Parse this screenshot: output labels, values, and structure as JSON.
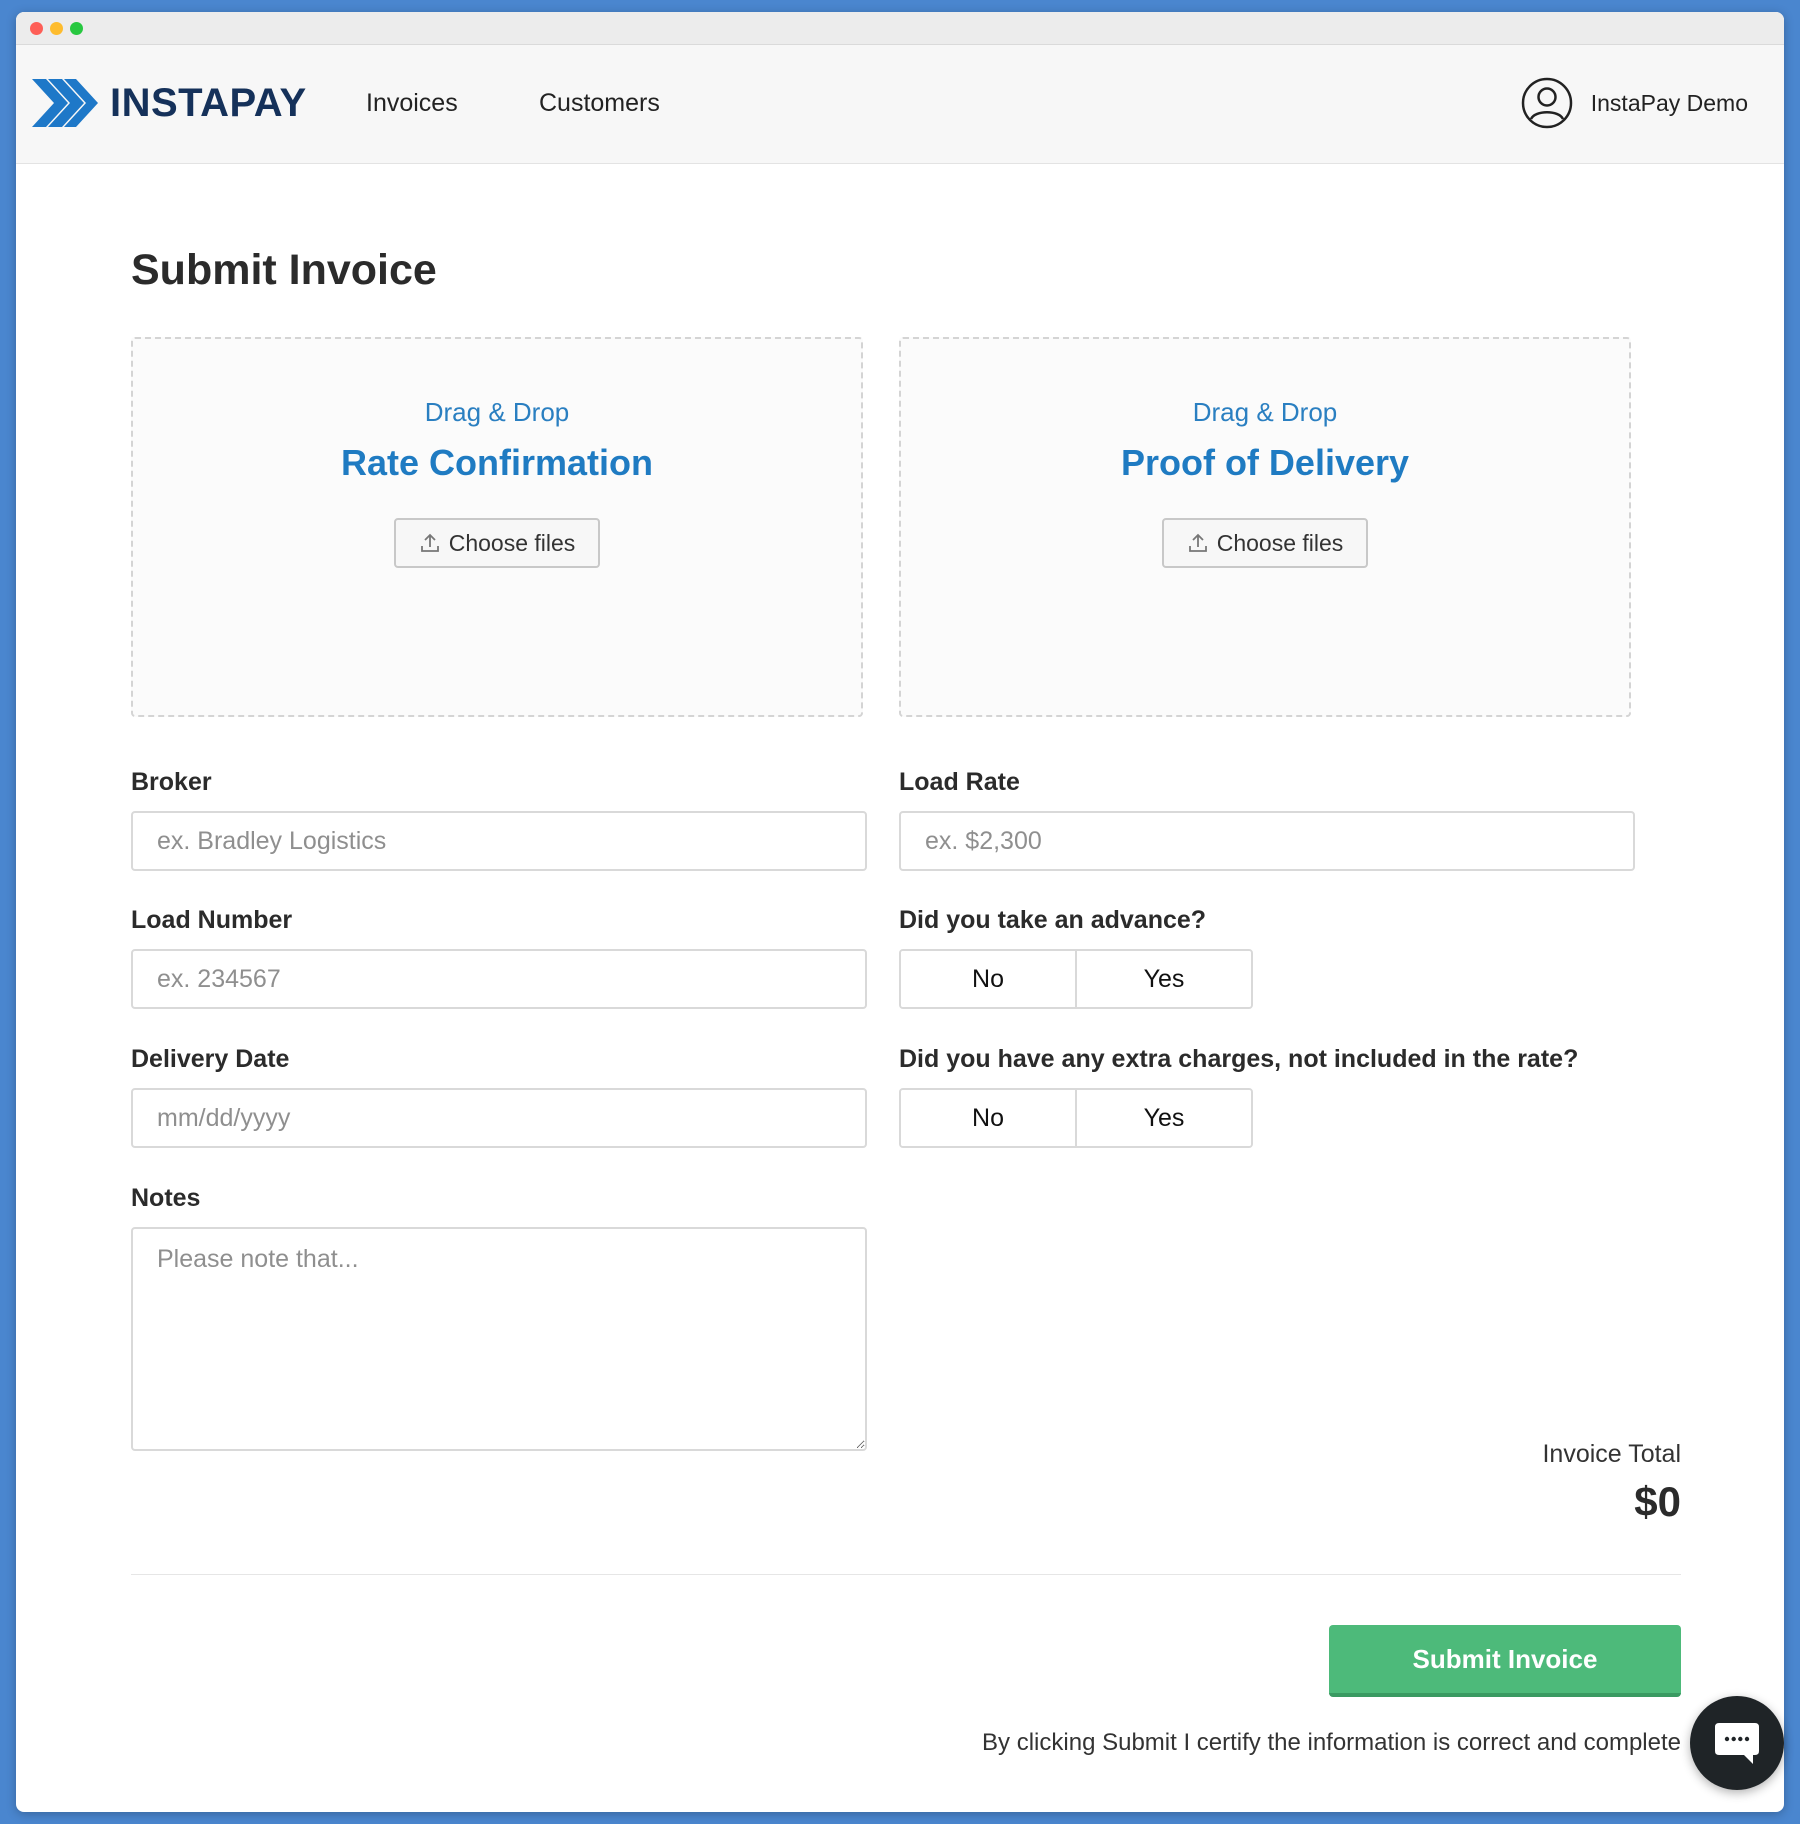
{
  "brand": {
    "name": "INSTAPAY"
  },
  "nav": {
    "links": [
      "Invoices",
      "Customers"
    ]
  },
  "user": {
    "name": "InstaPay Demo",
    "icon": "user-avatar-icon"
  },
  "page": {
    "title": "Submit Invoice"
  },
  "uploads": [
    {
      "hint": "Drag & Drop",
      "title": "Rate Confirmation",
      "button": "Choose files"
    },
    {
      "hint": "Drag & Drop",
      "title": "Proof of Delivery",
      "button": "Choose files"
    }
  ],
  "form": {
    "broker": {
      "label": "Broker",
      "placeholder": "ex. Bradley Logistics",
      "value": ""
    },
    "load_rate": {
      "label": "Load Rate",
      "placeholder": "ex. $2,300",
      "value": ""
    },
    "load_number": {
      "label": "Load Number",
      "placeholder": "ex. 234567",
      "value": ""
    },
    "delivery_date": {
      "label": "Delivery Date",
      "placeholder": "mm/dd/yyyy",
      "value": ""
    },
    "notes": {
      "label": "Notes",
      "placeholder": "Please note that...",
      "value": ""
    },
    "advance": {
      "label": "Did you take an advance?",
      "options": [
        "No",
        "Yes"
      ]
    },
    "extra_charges": {
      "label": "Did you have any extra charges, not included in the rate?",
      "options": [
        "No",
        "Yes"
      ]
    }
  },
  "total": {
    "label": "Invoice Total",
    "value": "$0"
  },
  "submit": {
    "label": "Submit Invoice",
    "disclaimer": "By clicking Submit I certify the information is correct and complete"
  },
  "colors": {
    "accent": "#1f7bc2",
    "brand_dark": "#15315a",
    "submit_green": "#4dba7a",
    "chat_fab": "#1f2427"
  }
}
